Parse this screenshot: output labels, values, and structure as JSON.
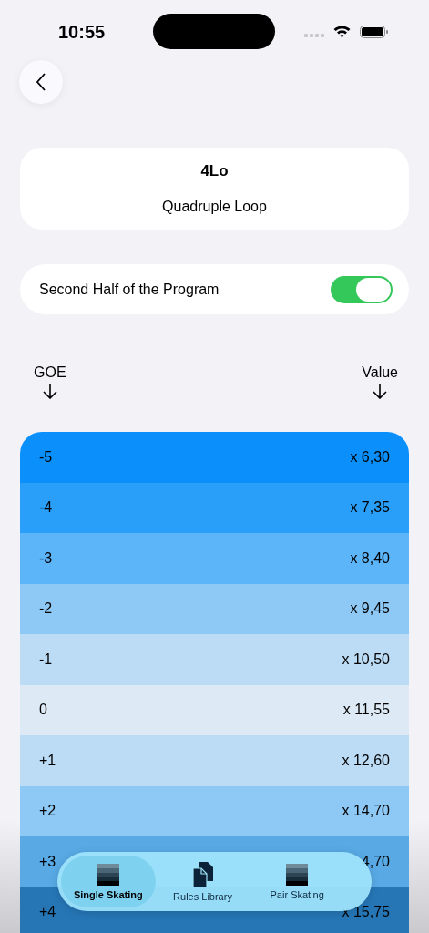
{
  "status_bar": {
    "time": "10:55"
  },
  "element": {
    "code": "4Lo",
    "name": "Quadruple Loop"
  },
  "second_half": {
    "label": "Second Half of the Program",
    "on": true
  },
  "columns": [
    "GOE",
    "Value"
  ],
  "rows": [
    {
      "goe": "-5",
      "value": "x 6,30",
      "color": "#0a8ffb"
    },
    {
      "goe": "-4",
      "value": "x 7,35",
      "color": "#2a9ffa"
    },
    {
      "goe": "-3",
      "value": "x 8,40",
      "color": "#5cb4f9"
    },
    {
      "goe": "-2",
      "value": "x 9,45",
      "color": "#8ec9f6"
    },
    {
      "goe": "-1",
      "value": "x 10,50",
      "color": "#bcdcf5"
    },
    {
      "goe": "0",
      "value": "x 11,55",
      "color": "#dde9f5"
    },
    {
      "goe": "+1",
      "value": "x 12,60",
      "color": "#bcdcf5"
    },
    {
      "goe": "+2",
      "value": "x 14,70",
      "color": "#8ec9f6"
    },
    {
      "goe": "+3",
      "value": "4,70",
      "color": "#58a9e4"
    },
    {
      "goe": "+4",
      "value": "x 15,75",
      "color": "#2676b6"
    }
  ],
  "tabs": [
    {
      "label": "Single Skating",
      "kind": "stripes",
      "selected": true
    },
    {
      "label": "Rules Library",
      "kind": "documents",
      "selected": false
    },
    {
      "label": "Pair Skating",
      "kind": "stripes",
      "selected": false
    }
  ]
}
